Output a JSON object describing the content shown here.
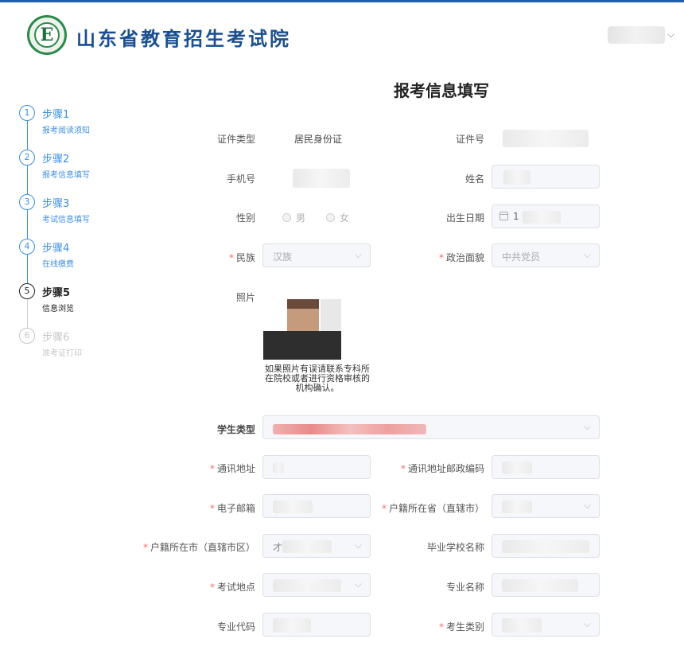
{
  "header": {
    "brand": "山东省教育招生考试院",
    "logo_letter": "E"
  },
  "page_title": "报考信息填写",
  "steps": [
    {
      "num": "1",
      "title": "步骤1",
      "desc": "报考阅读须知",
      "state": "done"
    },
    {
      "num": "2",
      "title": "步骤2",
      "desc": "报考信息填写",
      "state": "done"
    },
    {
      "num": "3",
      "title": "步骤3",
      "desc": "考试信息填写",
      "state": "done"
    },
    {
      "num": "4",
      "title": "步骤4",
      "desc": "在线缴费",
      "state": "done"
    },
    {
      "num": "5",
      "title": "步骤5",
      "desc": "信息浏览",
      "state": "current"
    },
    {
      "num": "6",
      "title": "步骤6",
      "desc": "准考证打印",
      "state": "pending"
    }
  ],
  "form": {
    "id_type_label": "证件类型",
    "id_type_value": "居民身份证",
    "id_no_label": "证件号",
    "phone_label": "手机号",
    "name_label": "姓名",
    "gender_label": "性别",
    "gender_male": "男",
    "gender_female": "女",
    "birth_label": "出生日期",
    "birth_prefix": "1",
    "ethnicity_label": "民族",
    "ethnicity_value": "汉族",
    "political_label": "政治面貌",
    "political_value": "中共党员",
    "photo_label": "照片",
    "photo_note": "如果照片有误请联系专科所在院校或者进行资格审核的机构确认。",
    "student_type_label": "学生类型",
    "address_label": "通讯地址",
    "postal_label": "通讯地址邮政编码",
    "email_label": "电子邮箱",
    "hukou_province_label": "户籍所在省（直辖市）",
    "hukou_city_label": "户籍所在市（直辖市区）",
    "hukou_city_prefix": "才",
    "school_label": "毕业学校名称",
    "exam_site_label": "考试地点",
    "major_name_label": "专业名称",
    "major_code_label": "专业代码",
    "candidate_type_label": "考生类别",
    "required_mark": "*"
  },
  "icons": {
    "select": "chevron-down-icon",
    "date": "calendar-icon"
  },
  "colors": {
    "primary": "#3d8fe0",
    "brand": "#1a4f8f",
    "required": "#f56c6c"
  }
}
